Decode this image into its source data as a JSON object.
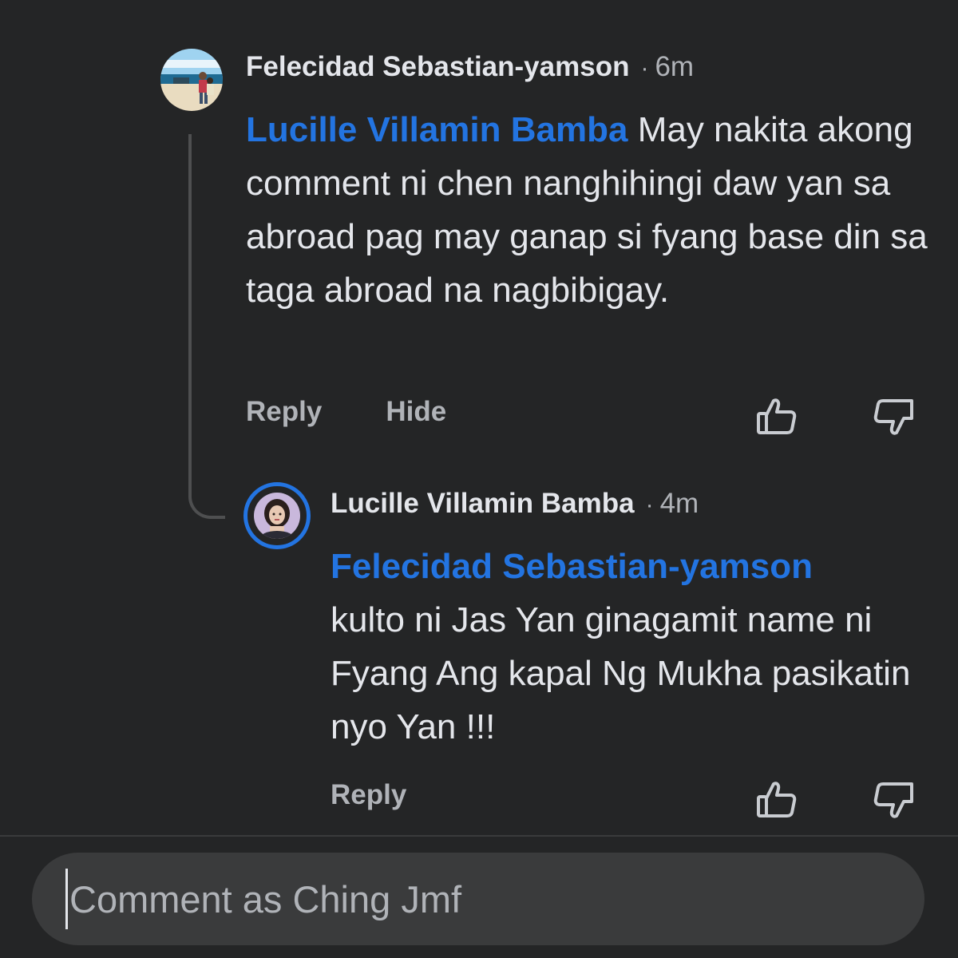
{
  "colors": {
    "background": "#242526",
    "mention": "#2374e1",
    "primary_text": "#e4e6eb",
    "secondary_text": "#b0b3b8",
    "input_background": "#3a3b3c"
  },
  "comments": [
    {
      "author": "Felecidad Sebastian-yamson",
      "separator": "·",
      "time": "6m",
      "mention": "Lucille Villamin Bamba",
      "text": " May nakita akong comment ni chen nanghihingi daw yan sa abroad pag may ganap si fyang base din sa taga abroad na nagbibigay.",
      "actions": {
        "reply": "Reply",
        "hide": "Hide"
      },
      "icons": {
        "like": "thumbs-up-icon",
        "dislike": "thumbs-down-icon"
      }
    },
    {
      "author": "Lucille Villamin Bamba",
      "separator": "·",
      "time": "4m",
      "mention": "Felecidad Sebastian-yamson",
      "text": "kulto ni Jas Yan ginagamit name ni Fyang Ang kapal Ng Mukha pasikatin nyo Yan !!!",
      "actions": {
        "reply": "Reply"
      },
      "icons": {
        "like": "thumbs-up-icon",
        "dislike": "thumbs-down-icon"
      }
    }
  ],
  "composer": {
    "placeholder": "Comment as Ching Jmf"
  }
}
